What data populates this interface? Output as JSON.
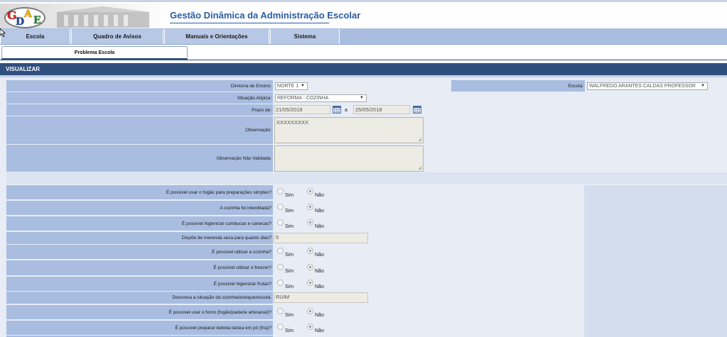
{
  "header": {
    "logo_text": "GDAE",
    "title": "Gestão Dinâmica da Administração Escolar"
  },
  "menu": {
    "items": [
      "Escola",
      "Quadro de Avisos",
      "Manuais e Orientações",
      "Sistema"
    ]
  },
  "tabs": [
    "Problema Escola"
  ],
  "section": {
    "title": "VISUALIZAR"
  },
  "form": {
    "diretoria_label": "Diretoria de Ensino:",
    "diretoria_value": "NORTE 1",
    "escola_label": "Escola:",
    "escola_value": "WALFREDO ARANTES CALDAS PROFESSOR",
    "situacao_label": "Situação Atípica:",
    "situacao_value": "REFORMA - COZINHA",
    "prazo_label": "Prazo de:",
    "prazo_de": "21/05/2018",
    "prazo_sep": "a",
    "prazo_ate": "25/05/2018",
    "observacao_label": "Observação:",
    "observacao_value": "XXXXXXXXX",
    "obs_nao_validada_label": "Observação Não Validada:",
    "obs_nao_validada_value": ""
  },
  "questions": [
    {
      "label": "É possível usar o fogão para preparações simples?",
      "type": "radio",
      "sim": "Sim",
      "nao": "Não",
      "selected": "nao"
    },
    {
      "label": "A cozinha foi interditada?",
      "type": "radio",
      "sim": "Sim",
      "nao": "Não",
      "selected": "nao"
    },
    {
      "label": "É possível higienizar cumbucas e canecas?",
      "type": "radio",
      "sim": "Sim",
      "nao": "Não",
      "selected": "nao"
    },
    {
      "label": "Dispõe de merenda seca para quanto dias?",
      "type": "text",
      "value": "5"
    },
    {
      "label": "É possível utilizar a cozinha?",
      "type": "radio",
      "sim": "Sim",
      "nao": "Não",
      "selected": "nao"
    },
    {
      "label": "É possível utilizar o freezer?",
      "type": "radio",
      "sim": "Sim",
      "nao": "Não",
      "selected": "nao"
    },
    {
      "label": "É possível higienizar frutas?",
      "type": "radio",
      "sim": "Sim",
      "nao": "Não",
      "selected": "nao"
    },
    {
      "label": "Descreva a situação da cozinha/estoque/escola.",
      "type": "text",
      "value": "RUIM"
    },
    {
      "label": "É possível usar o forno (fogão/padaria artesanal)?",
      "type": "radio",
      "sim": "Sim",
      "nao": "Não",
      "selected": "nao"
    },
    {
      "label": "É possível preparar bebida láctea em pó (fria)?",
      "type": "radio",
      "sim": "Sim",
      "nao": "Não",
      "selected": "nao"
    }
  ]
}
